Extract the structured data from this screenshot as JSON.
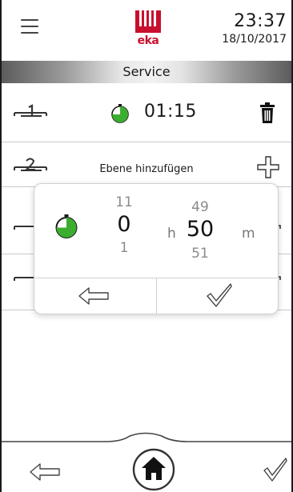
{
  "header": {
    "menu_icon": "hamburger-menu-icon",
    "logo": {
      "text": "eka",
      "brand_color": "#c8102e"
    },
    "time": "23:37",
    "date": "18/10/2017"
  },
  "titlebar": {
    "title": "Service"
  },
  "levels": [
    {
      "level_icon": "level-1-icon",
      "timer_icon": "timer-icon",
      "time": "01:15",
      "action_icon": "trash-icon"
    },
    {
      "level_icon": "level-2-icon",
      "label": "Ebene hinzufügen",
      "action_icon": "plus-icon"
    },
    {
      "level_icon": "level-3-icon"
    },
    {
      "level_icon": "level-4-icon"
    }
  ],
  "time_picker": {
    "timer_icon": "timer-icon",
    "hours": {
      "prev": "11",
      "current": "0",
      "next": "1",
      "unit": "h"
    },
    "minutes": {
      "prev": "49",
      "current": "50",
      "next": "51",
      "unit": "m"
    },
    "cancel_icon": "arrow-left-icon",
    "confirm_icon": "checkmark-icon"
  },
  "footer": {
    "back_icon": "arrow-left-icon",
    "home_icon": "home-icon",
    "confirm_icon": "checkmark-icon"
  },
  "colors": {
    "accent_green": "#3cae2f",
    "brand_red": "#c8102e",
    "divider": "#c9c9c9"
  }
}
